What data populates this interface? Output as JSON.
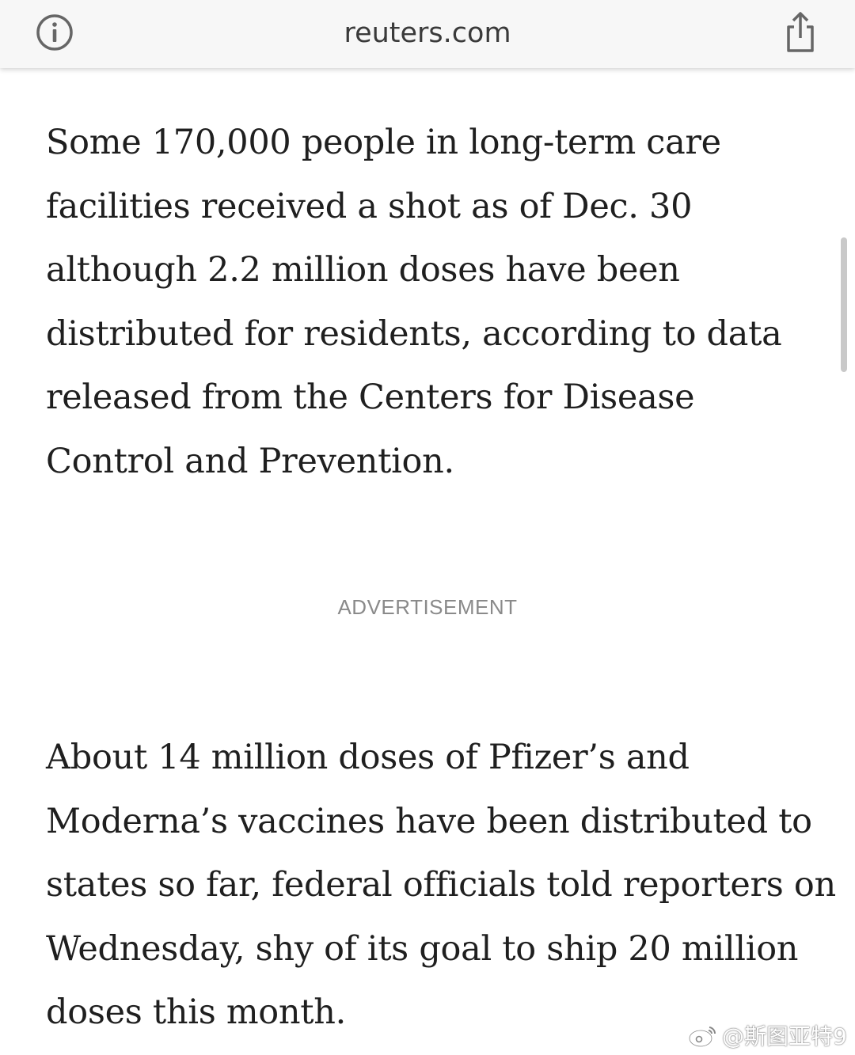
{
  "browser": {
    "url_text": "reuters.com",
    "info_icon": "info-icon",
    "share_icon": "share-icon"
  },
  "article": {
    "paragraph_1": "Some 170,000 people in long-term care facilities received a shot as of Dec. 30 although 2.2 million doses have been distributed for residents, according to data released from the Centers for Disease Control and Prevention.",
    "ad_label": "ADVERTISEMENT",
    "paragraph_2": "About 14 million doses of Pfizer’s and Moderna’s vaccines have been distributed to states so far, federal officials told reporters on Wednesday, shy of its goal to ship 20 million doses this month."
  },
  "watermark": {
    "text": "@斯图亚特9",
    "icon": "weibo-icon"
  }
}
